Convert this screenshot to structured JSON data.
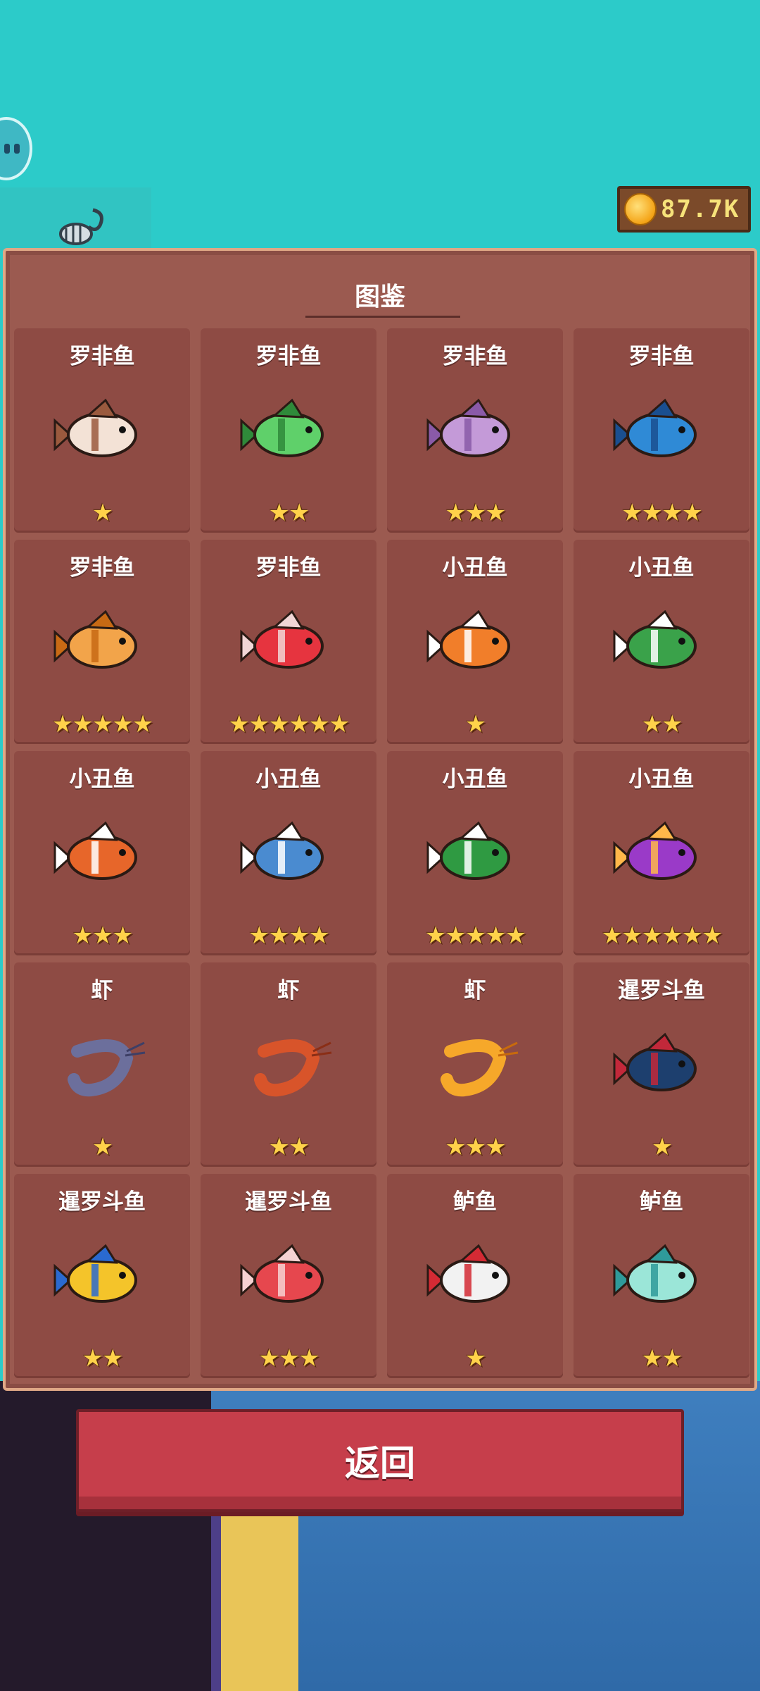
{
  "hud": {
    "coins": "87.7K"
  },
  "panel": {
    "title": "图鉴"
  },
  "return_label": "返回",
  "fish": [
    {
      "name": "罗非鱼",
      "stars": 1,
      "body": "#f3e2d6",
      "accent": "#9a5a3e"
    },
    {
      "name": "罗非鱼",
      "stars": 2,
      "body": "#5fd06a",
      "accent": "#2f8a3a"
    },
    {
      "name": "罗非鱼",
      "stars": 3,
      "body": "#c49ad8",
      "accent": "#8a5aa8"
    },
    {
      "name": "罗非鱼",
      "stars": 4,
      "body": "#2f8ad6",
      "accent": "#1a4f90"
    },
    {
      "name": "罗非鱼",
      "stars": 5,
      "body": "#f2a44a",
      "accent": "#c86a14"
    },
    {
      "name": "罗非鱼",
      "stars": 6,
      "body": "#e6343f",
      "accent": "#f1d6d6"
    },
    {
      "name": "小丑鱼",
      "stars": 1,
      "body": "#f17e2a",
      "accent": "#ffffff"
    },
    {
      "name": "小丑鱼",
      "stars": 2,
      "body": "#3aa24a",
      "accent": "#ffffff"
    },
    {
      "name": "小丑鱼",
      "stars": 3,
      "body": "#e7662a",
      "accent": "#ffffff"
    },
    {
      "name": "小丑鱼",
      "stars": 4,
      "body": "#4a8bd0",
      "accent": "#ffffff"
    },
    {
      "name": "小丑鱼",
      "stars": 5,
      "body": "#2f9a42",
      "accent": "#ffffff"
    },
    {
      "name": "小丑鱼",
      "stars": 6,
      "body": "#9a3ac8",
      "accent": "#ffb84a"
    },
    {
      "name": "虾",
      "stars": 1,
      "body": "#6c6f9c",
      "accent": "#3e3f66"
    },
    {
      "name": "虾",
      "stars": 2,
      "body": "#d8542a",
      "accent": "#8a2e16"
    },
    {
      "name": "虾",
      "stars": 3,
      "body": "#f6a82a",
      "accent": "#c86a0c"
    },
    {
      "name": "暹罗斗鱼",
      "stars": 1,
      "body": "#1d3f6e",
      "accent": "#c2283a"
    },
    {
      "name": "暹罗斗鱼",
      "stars": 2,
      "body": "#f4c42a",
      "accent": "#2a6ad0"
    },
    {
      "name": "暹罗斗鱼",
      "stars": 3,
      "body": "#e6474e",
      "accent": "#f6d2d2"
    },
    {
      "name": "鲈鱼",
      "stars": 1,
      "body": "#f2f2f2",
      "accent": "#d42a34"
    },
    {
      "name": "鲈鱼",
      "stars": 2,
      "body": "#9be6d8",
      "accent": "#2f9a9a"
    }
  ]
}
